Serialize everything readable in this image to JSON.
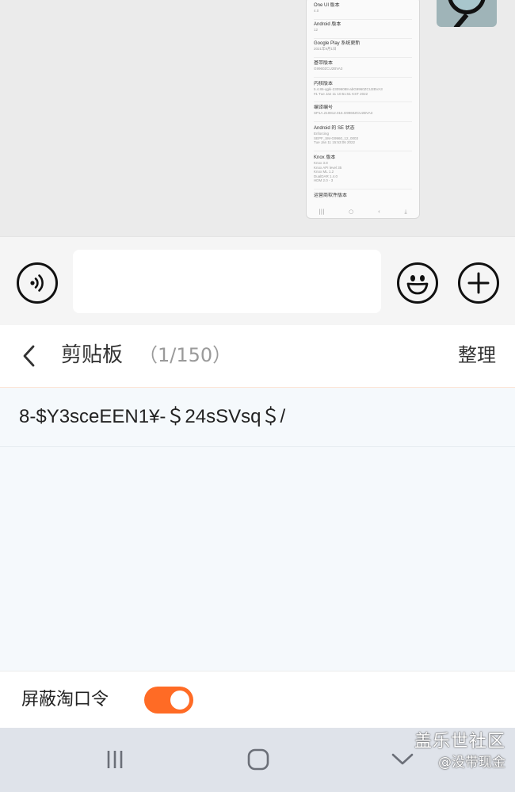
{
  "screenshot": {
    "rows": [
      {
        "title": "One UI 版本",
        "sub": "4.0"
      },
      {
        "title": "Android 版本",
        "sub": "12"
      },
      {
        "title": "Google Play 系统更新",
        "sub": "2021年9月1日"
      },
      {
        "title": "基带版本",
        "sub": "G9960ZCU2BVA3"
      },
      {
        "title": "内核版本",
        "sub": "5.4.86-qgki-23096088-abG9960ZCU2BVA3\n#1 Tue Jan 11 10:51:51 KST 2022"
      },
      {
        "title": "编译编号",
        "sub": "SP1A.210812.016.G9960ZCU2BVA3"
      },
      {
        "title": "Android 的 SE 状态",
        "sub": "Enforcing\nSEPF_SM-G9960_12_0003\nTue Jan 11 15:53:06 2022"
      },
      {
        "title": "Knox 版本",
        "sub": "Knox 3.8\nKnox API level 35\nKnox ML 1.2\nDualDAR 1.4.0\nHDM 2.0 - 3"
      },
      {
        "title": "运营商软件版本",
        "sub": ""
      }
    ]
  },
  "clipboard": {
    "title": "剪贴板",
    "count": "（1/150）",
    "organize_label": "整理",
    "items": [
      "8-$Y3sceEEN1¥-＄24sSVsq＄/"
    ],
    "block_label": "屏蔽淘口令",
    "block_enabled": true
  },
  "watermark": {
    "line1": "盖乐世社区",
    "line2": "@没带现金"
  },
  "colors": {
    "accent": "#ff6b25",
    "nav_bg": "#dfe3ea"
  }
}
